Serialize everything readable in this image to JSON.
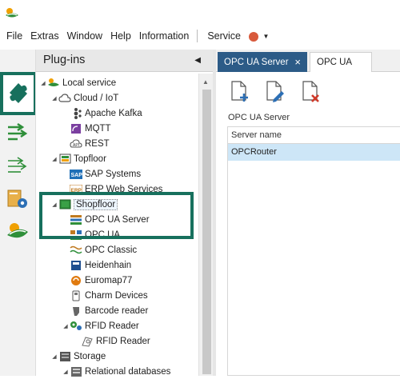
{
  "menubar": {
    "items": [
      "File",
      "Extras",
      "Window",
      "Help",
      "Information"
    ],
    "service_label": "Service"
  },
  "plugins": {
    "title": "Plug-ins",
    "tree": [
      {
        "label": "Local service",
        "icon": "local-service-icon"
      },
      {
        "label": "Cloud / IoT",
        "icon": "cloud-icon"
      },
      {
        "label": "Apache Kafka",
        "icon": "kafka-icon"
      },
      {
        "label": "MQTT",
        "icon": "mqtt-icon"
      },
      {
        "label": "REST",
        "icon": "rest-icon"
      },
      {
        "label": "Topfloor",
        "icon": "folder-icon"
      },
      {
        "label": "SAP Systems",
        "icon": "sap-icon"
      },
      {
        "label": "ERP Web Services",
        "icon": "erp-icon"
      },
      {
        "label": "Shopfloor",
        "icon": "folder-icon"
      },
      {
        "label": "OPC UA Server",
        "icon": "opc-ua-server-icon"
      },
      {
        "label": "OPC UA",
        "icon": "opc-ua-icon"
      },
      {
        "label": "OPC Classic",
        "icon": "opc-classic-icon"
      },
      {
        "label": "Heidenhain",
        "icon": "heidenhain-icon"
      },
      {
        "label": "Euromap77",
        "icon": "euromap-icon"
      },
      {
        "label": "Charm Devices",
        "icon": "charm-icon"
      },
      {
        "label": "Barcode reader",
        "icon": "barcode-icon"
      },
      {
        "label": "RFID Reader",
        "icon": "rfid-group-icon"
      },
      {
        "label": "RFID Reader",
        "icon": "rfid-icon"
      },
      {
        "label": "Storage",
        "icon": "storage-icon"
      },
      {
        "label": "Relational databases",
        "icon": "database-icon"
      }
    ]
  },
  "tabs": [
    {
      "label": "OPC UA Server",
      "active": true,
      "close": "×"
    },
    {
      "label": "OPC UA",
      "active": false
    }
  ],
  "content": {
    "title": "OPC UA Server",
    "grid": {
      "column": "Server name",
      "rows": [
        "OPCRouter"
      ]
    }
  },
  "colors": {
    "accent_green": "#17705d",
    "tab_active": "#2c5b87",
    "selection": "#cde6f7",
    "status_dot": "#d85a3c"
  }
}
